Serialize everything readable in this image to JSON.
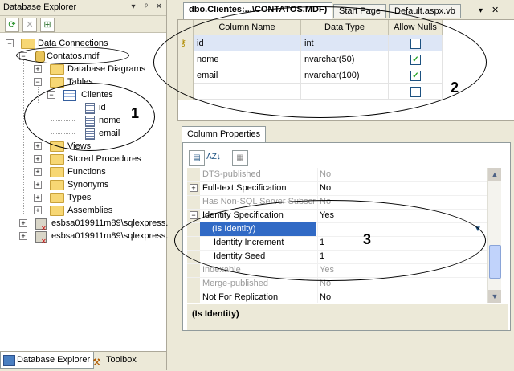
{
  "left_panel": {
    "title": "Database Explorer",
    "title_buttons": [
      "▾",
      "ᵖ",
      "✕"
    ],
    "tree": {
      "root": "Data Connections",
      "db": "Contatos.mdf",
      "items": [
        "Database Diagrams",
        "Tables"
      ],
      "table": "Clientes",
      "columns": [
        "id",
        "nome",
        "email"
      ],
      "more_items": [
        "Views",
        "Stored Procedures",
        "Functions",
        "Synonyms",
        "Types",
        "Assemblies"
      ],
      "servers": [
        "esbsa019911m89\\sqlexpress.",
        "esbsa019911m89\\sqlexpress."
      ]
    },
    "bottom_tabs": [
      "Database Explorer",
      "Toolbox"
    ]
  },
  "doc_tabs": [
    "dbo.Clientes:...\\CONTATOS.MDF)",
    "Start Page",
    "Default.aspx.vb"
  ],
  "grid": {
    "headers": [
      "Column Name",
      "Data Type",
      "Allow Nulls"
    ],
    "rows": [
      {
        "name": "id",
        "type": "int",
        "nulls": false
      },
      {
        "name": "nome",
        "type": "nvarchar(50)",
        "nulls": true
      },
      {
        "name": "email",
        "type": "nvarchar(100)",
        "nulls": true
      },
      {
        "name": "",
        "type": "",
        "nulls": false
      }
    ]
  },
  "properties": {
    "tab": "Column Properties",
    "rows": [
      {
        "name": "DTS-published",
        "value": "No"
      },
      {
        "name": "Full-text Specification",
        "value": "No"
      },
      {
        "name": "Has Non-SQL Server Subscriber",
        "value": "No"
      },
      {
        "name": "Identity Specification",
        "value": "Yes"
      },
      {
        "name": "(Is Identity)",
        "value": ""
      },
      {
        "name": "Identity Increment",
        "value": "1"
      },
      {
        "name": "Identity Seed",
        "value": "1"
      },
      {
        "name": "Indexable",
        "value": "Yes"
      },
      {
        "name": "Merge-published",
        "value": "No"
      },
      {
        "name": "Not For Replication",
        "value": "No"
      }
    ],
    "description": "(Is Identity)"
  },
  "annotations": [
    "1",
    "2",
    "3"
  ]
}
